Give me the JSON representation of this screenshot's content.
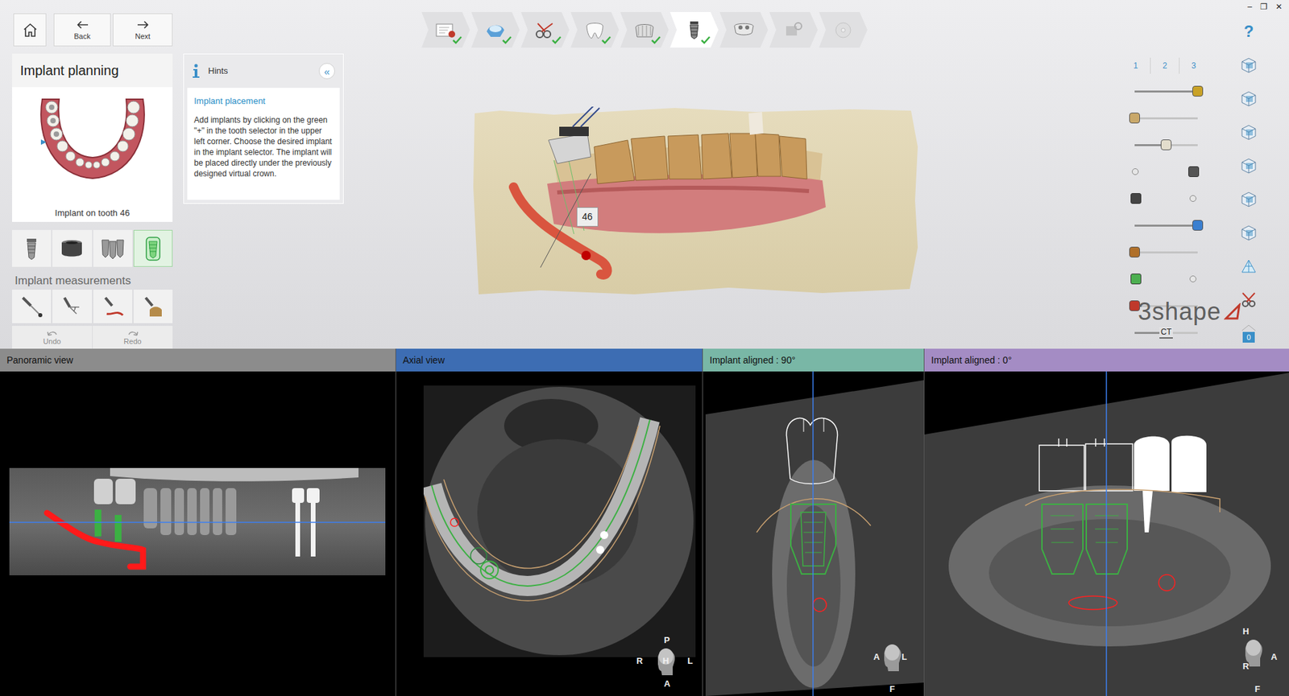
{
  "window_controls": [
    "–",
    "❐",
    "✕"
  ],
  "nav": [
    {
      "label": "Back",
      "kind": "back"
    },
    {
      "label": "Next",
      "kind": "next"
    }
  ],
  "steps": [
    {
      "done": true,
      "selected": false,
      "disabled": false
    },
    {
      "done": true,
      "selected": false,
      "disabled": false
    },
    {
      "done": true,
      "selected": false,
      "disabled": false
    },
    {
      "done": true,
      "selected": false,
      "disabled": false
    },
    {
      "done": true,
      "selected": false,
      "disabled": false
    },
    {
      "done": true,
      "selected": true,
      "disabled": false
    },
    {
      "done": false,
      "selected": false,
      "disabled": false
    },
    {
      "done": false,
      "selected": false,
      "disabled": true
    },
    {
      "done": false,
      "selected": false,
      "disabled": true
    }
  ],
  "panel": {
    "title": "Implant planning",
    "caption": "Implant on tooth 46"
  },
  "tools": [
    {
      "kind": "implant",
      "selected": false
    },
    {
      "kind": "abutment",
      "selected": false
    },
    {
      "kind": "multi",
      "selected": false
    },
    {
      "kind": "guided",
      "selected": true
    }
  ],
  "measurements": {
    "title": "Implant measurements",
    "tools": [
      {
        "kind": "distance"
      },
      {
        "kind": "angle"
      },
      {
        "kind": "nerve"
      },
      {
        "kind": "bone"
      }
    ]
  },
  "history": [
    {
      "label": "Undo",
      "disabled": true
    },
    {
      "label": "Redo",
      "disabled": true
    }
  ],
  "hints": {
    "title": "Hints",
    "collapse": "«",
    "heading": "Implant placement",
    "body": "Add implants by clicking on the green \"+\" in the tooth selector in the upper left corner. Choose the desired implant in the implant selector. The implant will be placed directly under the previously designed virtual crown."
  },
  "scene": {
    "tooth_label": "46"
  },
  "layers": {
    "columns": [
      "1",
      "2",
      "3"
    ],
    "rows": [
      {
        "kind": "slider",
        "level": 1,
        "color": "#c9a227"
      },
      {
        "kind": "slider",
        "level": 0,
        "color": "#c9a86a"
      },
      {
        "kind": "slider",
        "level": 0.5,
        "color": "#e3ddcc"
      },
      {
        "kind": "toggle",
        "on": true,
        "color": "#555555"
      },
      {
        "kind": "toggle",
        "on": false,
        "color": "#444444"
      },
      {
        "kind": "slider",
        "level": 1,
        "color": "#3a7fd0"
      },
      {
        "kind": "slider",
        "level": 0,
        "color": "#b0702a"
      },
      {
        "kind": "toggle",
        "on": false,
        "color": "#4caf50"
      },
      {
        "kind": "slider",
        "level": 0,
        "color": "#c0392b"
      },
      {
        "kind": "slider",
        "level": 0.5,
        "label": "CT",
        "color": "#666666"
      }
    ]
  },
  "help": "?",
  "side_icons": [
    {
      "kind": "cube"
    },
    {
      "kind": "cube"
    },
    {
      "kind": "cube"
    },
    {
      "kind": "cube"
    },
    {
      "kind": "cube"
    },
    {
      "kind": "cube"
    },
    {
      "kind": "mesh"
    },
    {
      "kind": "cut"
    },
    {
      "kind": "counter",
      "badge": "0"
    }
  ],
  "logo": "3shape",
  "views": [
    {
      "title": "Panoramic view",
      "kind": "panoramic",
      "color": "#8c8c8c",
      "orientation": []
    },
    {
      "title": "Axial view",
      "kind": "axial",
      "color": "#3d6db3",
      "orientation": [
        "P",
        "R",
        "H",
        "L",
        "A"
      ]
    },
    {
      "title": "Implant aligned : 90°",
      "kind": "cross",
      "color": "#79b7a6",
      "orientation": [
        "A",
        "L",
        "F"
      ]
    },
    {
      "title": "Implant aligned : 0°",
      "kind": "long",
      "color": "#a48cc4",
      "orientation": [
        "H",
        "R",
        "A",
        "F"
      ]
    }
  ]
}
